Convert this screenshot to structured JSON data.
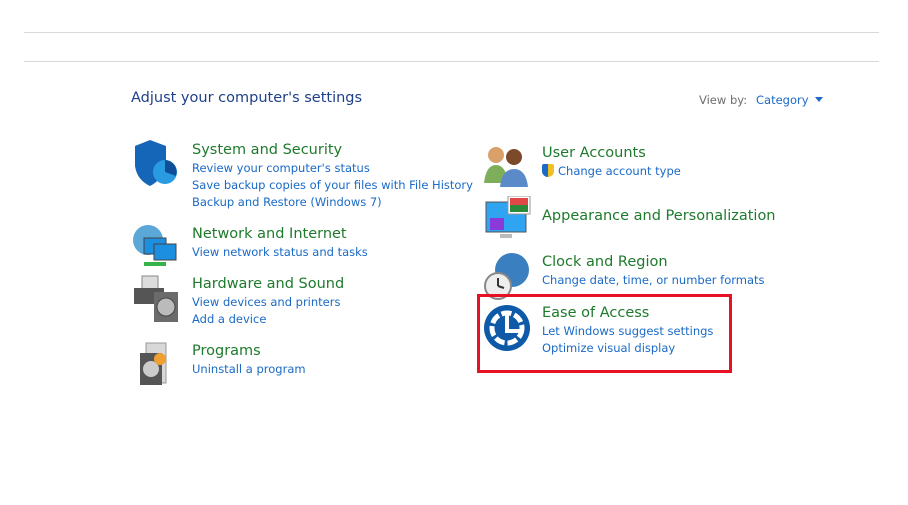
{
  "header": {
    "title": "Adjust your computer's settings",
    "view_by_label": "View by:",
    "view_by_value": "Category"
  },
  "categories": [
    {
      "title": "System and Security",
      "links": [
        "Review your computer's status",
        "Save backup copies of your files with File History",
        "Backup and Restore (Windows 7)"
      ]
    },
    {
      "title": "Network and Internet",
      "links": [
        "View network status and tasks"
      ]
    },
    {
      "title": "Hardware and Sound",
      "links": [
        "View devices and printers",
        "Add a device"
      ]
    },
    {
      "title": "Programs",
      "links": [
        "Uninstall a program"
      ]
    },
    {
      "title": "User Accounts",
      "links": [
        "Change account type"
      ]
    },
    {
      "title": "Appearance and Personalization",
      "links": []
    },
    {
      "title": "Clock and Region",
      "links": [
        "Change date, time, or number formats"
      ]
    },
    {
      "title": "Ease of Access",
      "links": [
        "Let Windows suggest settings",
        "Optimize visual display"
      ]
    }
  ],
  "colors": {
    "title": "#1e7a2c",
    "link": "#1a6ac6",
    "highlight": "#e81123"
  }
}
